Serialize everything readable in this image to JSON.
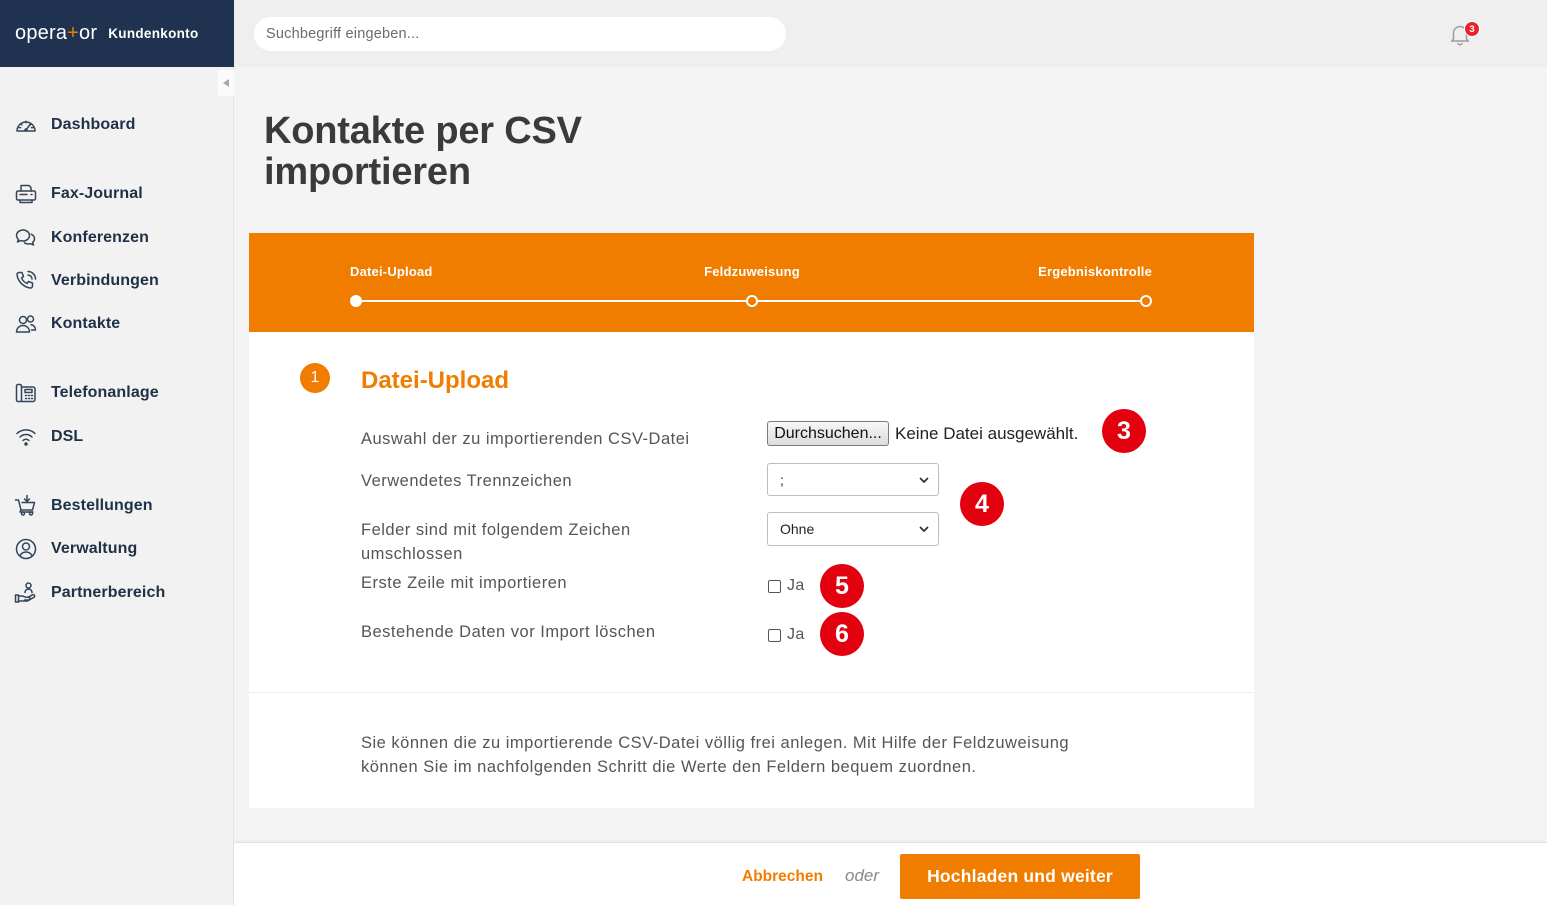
{
  "header": {
    "logo": {
      "pre": "opera",
      "plus": "+",
      "post": "or"
    },
    "account_label": "Kundenkonto",
    "search": {
      "placeholder": "Suchbegriff eingeben...",
      "value": ""
    },
    "notifications": {
      "icon": "bell-icon",
      "count": "3"
    }
  },
  "sidebar": {
    "collapse_icon": "caret-left-icon",
    "items": [
      {
        "label": "Dashboard",
        "icon": "speedometer-icon"
      },
      {
        "label": "Fax-Journal",
        "icon": "fax-icon"
      },
      {
        "label": "Konferenzen",
        "icon": "chat-bubbles-icon"
      },
      {
        "label": "Verbindungen",
        "icon": "phone-call-icon"
      },
      {
        "label": "Kontakte",
        "icon": "contacts-icon"
      },
      {
        "label": "Telefonanlage",
        "icon": "desk-phone-icon"
      },
      {
        "label": "DSL",
        "icon": "wifi-icon"
      },
      {
        "label": "Bestellungen",
        "icon": "shopping-cart-icon"
      },
      {
        "label": "Verwaltung",
        "icon": "user-circle-icon"
      },
      {
        "label": "Partnerbereich",
        "icon": "partner-hand-icon"
      }
    ]
  },
  "page": {
    "title": "Kontakte per CSV importieren"
  },
  "wizard": {
    "steps": [
      {
        "label": "Datei-Upload",
        "current": true
      },
      {
        "label": "Feldzuweisung",
        "current": false
      },
      {
        "label": "Ergebniskontrolle",
        "current": false
      }
    ]
  },
  "section": {
    "number": "1",
    "title": "Datei-Upload",
    "fields": {
      "csv_file": {
        "label": "Auswahl der zu importierenden CSV-Datei",
        "button_label": "Durchsuchen...",
        "status": "Keine Datei ausgewählt."
      },
      "separator": {
        "label": "Verwendetes Trennzeichen",
        "selected": ";"
      },
      "enclosure": {
        "label": "Felder sind mit folgendem Zeichen umschlossen",
        "selected": "Ohne"
      },
      "first_row": {
        "label": "Erste Zeile mit importieren",
        "option_label": "Ja",
        "checked": false
      },
      "clear_existing": {
        "label": "Bestehende Daten vor Import löschen",
        "option_label": "Ja",
        "checked": false
      }
    },
    "info_text": "Sie können die zu importierende CSV-Datei völlig frei anlegen. Mit Hilfe der Feldzuweisung können Sie im nachfolgenden Schritt die Werte den Feldern bequem zuordnen."
  },
  "annotations": [
    {
      "number": "3"
    },
    {
      "number": "4"
    },
    {
      "number": "5"
    },
    {
      "number": "6"
    }
  ],
  "footer": {
    "cancel_label": "Abbrechen",
    "or_label": "oder",
    "submit_label": "Hochladen und weiter"
  },
  "colors": {
    "accent": "#f07c00",
    "navy": "#1f3350",
    "nav_text": "#1f3147",
    "annotation": "#e3000f",
    "badge": "#e5242b"
  }
}
